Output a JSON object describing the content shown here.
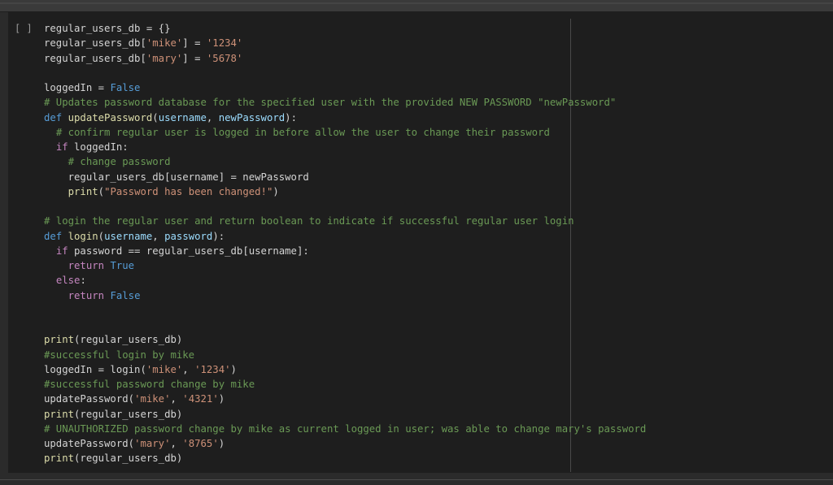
{
  "cell": {
    "run_indicator": "[ ]",
    "lines": [
      [
        {
          "t": "regular_users_db = {}",
          "c": ""
        }
      ],
      [
        {
          "t": "regular_users_db[",
          "c": ""
        },
        {
          "t": "'mike'",
          "c": "str"
        },
        {
          "t": "] = ",
          "c": ""
        },
        {
          "t": "'1234'",
          "c": "str"
        }
      ],
      [
        {
          "t": "regular_users_db[",
          "c": ""
        },
        {
          "t": "'mary'",
          "c": "str"
        },
        {
          "t": "] = ",
          "c": ""
        },
        {
          "t": "'5678'",
          "c": "str"
        }
      ],
      [],
      [
        {
          "t": "loggedIn = ",
          "c": ""
        },
        {
          "t": "False",
          "c": "bool"
        }
      ],
      [
        {
          "t": "# Updates password database for the specified user with the provided NEW PASSWORD \"newPassword\"",
          "c": "cmt"
        }
      ],
      [
        {
          "t": "def ",
          "c": "def"
        },
        {
          "t": "updatePassword",
          "c": "fn"
        },
        {
          "t": "(",
          "c": ""
        },
        {
          "t": "username",
          "c": "par"
        },
        {
          "t": ", ",
          "c": ""
        },
        {
          "t": "newPassword",
          "c": "par"
        },
        {
          "t": "):",
          "c": ""
        }
      ],
      [
        {
          "t": "  ",
          "c": ""
        },
        {
          "t": "# confirm regular user is logged in before allow the user to change their password",
          "c": "cmt"
        }
      ],
      [
        {
          "t": "  ",
          "c": ""
        },
        {
          "t": "if",
          "c": "kw"
        },
        {
          "t": " loggedIn:",
          "c": ""
        }
      ],
      [
        {
          "t": "    ",
          "c": ""
        },
        {
          "t": "# change password",
          "c": "cmt"
        }
      ],
      [
        {
          "t": "    regular_users_db[username] = newPassword",
          "c": ""
        }
      ],
      [
        {
          "t": "    ",
          "c": ""
        },
        {
          "t": "print",
          "c": "fn"
        },
        {
          "t": "(",
          "c": ""
        },
        {
          "t": "\"Password has been changed!\"",
          "c": "str"
        },
        {
          "t": ")",
          "c": ""
        }
      ],
      [],
      [
        {
          "t": "# login the regular user and return boolean to indicate if successful regular user login",
          "c": "cmt"
        }
      ],
      [
        {
          "t": "def ",
          "c": "def"
        },
        {
          "t": "login",
          "c": "fn"
        },
        {
          "t": "(",
          "c": ""
        },
        {
          "t": "username",
          "c": "par"
        },
        {
          "t": ", ",
          "c": ""
        },
        {
          "t": "password",
          "c": "par"
        },
        {
          "t": "):",
          "c": ""
        }
      ],
      [
        {
          "t": "  ",
          "c": ""
        },
        {
          "t": "if",
          "c": "kw"
        },
        {
          "t": " password == regular_users_db[username]:",
          "c": ""
        }
      ],
      [
        {
          "t": "    ",
          "c": ""
        },
        {
          "t": "return",
          "c": "kw"
        },
        {
          "t": " ",
          "c": ""
        },
        {
          "t": "True",
          "c": "bool"
        }
      ],
      [
        {
          "t": "  ",
          "c": ""
        },
        {
          "t": "else",
          "c": "kw"
        },
        {
          "t": ":",
          "c": ""
        }
      ],
      [
        {
          "t": "    ",
          "c": ""
        },
        {
          "t": "return",
          "c": "kw"
        },
        {
          "t": " ",
          "c": ""
        },
        {
          "t": "False",
          "c": "bool"
        }
      ],
      [],
      [],
      [
        {
          "t": "print",
          "c": "fn"
        },
        {
          "t": "(regular_users_db)",
          "c": ""
        }
      ],
      [
        {
          "t": "#successful login by mike",
          "c": "cmt"
        }
      ],
      [
        {
          "t": "loggedIn = login(",
          "c": ""
        },
        {
          "t": "'mike'",
          "c": "str"
        },
        {
          "t": ", ",
          "c": ""
        },
        {
          "t": "'1234'",
          "c": "str"
        },
        {
          "t": ")",
          "c": ""
        }
      ],
      [
        {
          "t": "#successful password change by mike",
          "c": "cmt"
        }
      ],
      [
        {
          "t": "updatePassword(",
          "c": ""
        },
        {
          "t": "'mike'",
          "c": "str"
        },
        {
          "t": ", ",
          "c": ""
        },
        {
          "t": "'4321'",
          "c": "str"
        },
        {
          "t": ")",
          "c": ""
        }
      ],
      [
        {
          "t": "print",
          "c": "fn"
        },
        {
          "t": "(regular_users_db)",
          "c": ""
        }
      ],
      [
        {
          "t": "# UNAUTHORIZED password change by mike as current logged in user; was able to change mary's password",
          "c": "cmt"
        }
      ],
      [
        {
          "t": "updatePassword(",
          "c": ""
        },
        {
          "t": "'mary'",
          "c": "str"
        },
        {
          "t": ", ",
          "c": ""
        },
        {
          "t": "'8765'",
          "c": "str"
        },
        {
          "t": ")",
          "c": ""
        }
      ],
      [
        {
          "t": "print",
          "c": "fn"
        },
        {
          "t": "(regular_users_db)",
          "c": ""
        }
      ]
    ]
  }
}
